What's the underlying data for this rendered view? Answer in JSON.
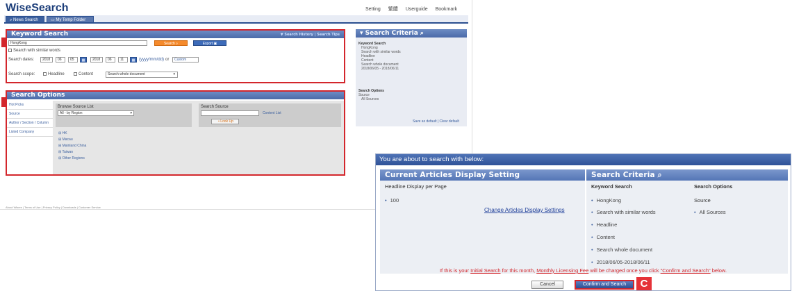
{
  "app": {
    "logo": "WiseSearch"
  },
  "top_links": [
    "Setting",
    "繁體",
    "Userguide",
    "Bookmark"
  ],
  "tabs": [
    "News Search",
    "My Temp Folder"
  ],
  "keyword_search": {
    "title": "Keyword Search",
    "header_links": "▼ Search History  |  Search Tips",
    "keyword_value": "HongKong",
    "search_button": "Search",
    "export_button": "Export",
    "similar_words_label": "Search with similar words",
    "dates_label": "Search dates:",
    "date_from": [
      "2018",
      "06",
      "05"
    ],
    "date_to": [
      "2018",
      "06",
      "11"
    ],
    "date_format": "(yyyy/mm/dd)",
    "or_label": "or",
    "range_select": "Custom",
    "scope_label": "Search scope:",
    "headline_label": "Headline",
    "content_label": "Content",
    "scope_select": "Search whole document"
  },
  "search_options": {
    "title": "Search Options",
    "side_items": [
      "Hot Picks",
      "Source",
      "Author / Section / Column",
      "Listed Company"
    ],
    "browse_label": "Browse Source List",
    "browse_select": "All - by Region",
    "source_label": "Search Source",
    "content_list_link": "Content List",
    "lookup_button": "Look Up",
    "regions": [
      "HK",
      "Macau",
      "Mainland China",
      "Taiwan",
      "Other Regions"
    ]
  },
  "criteria_panel": {
    "title": "Search Criteria",
    "kw_heading": "Keyword Search",
    "kw_items": [
      "HongKong",
      "Search with similar words",
      "Headline",
      "Content",
      "Search whole document",
      "2018/06/05 - 2018/06/11"
    ],
    "opt_heading": "Search Options",
    "source_label": "Source",
    "source_item": "All Sources",
    "footer_links": "Save as default  |  Clear default"
  },
  "footer_text": "About Wisers  |  Terms of Use  |  Privacy Policy  |  Downloads  |  Customer Service",
  "dialog": {
    "title": "You are about to search with below:",
    "display_section": {
      "title": "Current Articles Display Setting",
      "label": "Headline Display per Page",
      "value": "100",
      "change_link": "Change Articles Display Settings"
    },
    "criteria_section": {
      "title": "Search Criteria",
      "kw_heading": "Keyword Search",
      "kw_items": [
        "HongKong",
        "Search with similar words",
        "Headline",
        "Content",
        "Search whole document",
        "2018/06/05-2018/06/11"
      ],
      "opt_heading": "Search Options",
      "source_label": "Source",
      "source_item": "All Sources"
    },
    "notice": {
      "p1": "If this is your ",
      "initial_search": "Initial Search",
      "p2": " for this month, ",
      "fee": "Monthly Licensing Fee",
      "p3": " will be charged once you click ",
      "confirm_quote": "\"Confirm and Search\"",
      "p4": " below."
    },
    "cancel_button": "Cancel",
    "confirm_button": "Confirm and Search"
  },
  "callouts": {
    "a": "A",
    "b": "B",
    "c": "C"
  },
  "colors": {
    "brand_blue": "#2a4f8f",
    "highlight_red": "#d3262c",
    "accent_orange": "#f58a2c"
  }
}
